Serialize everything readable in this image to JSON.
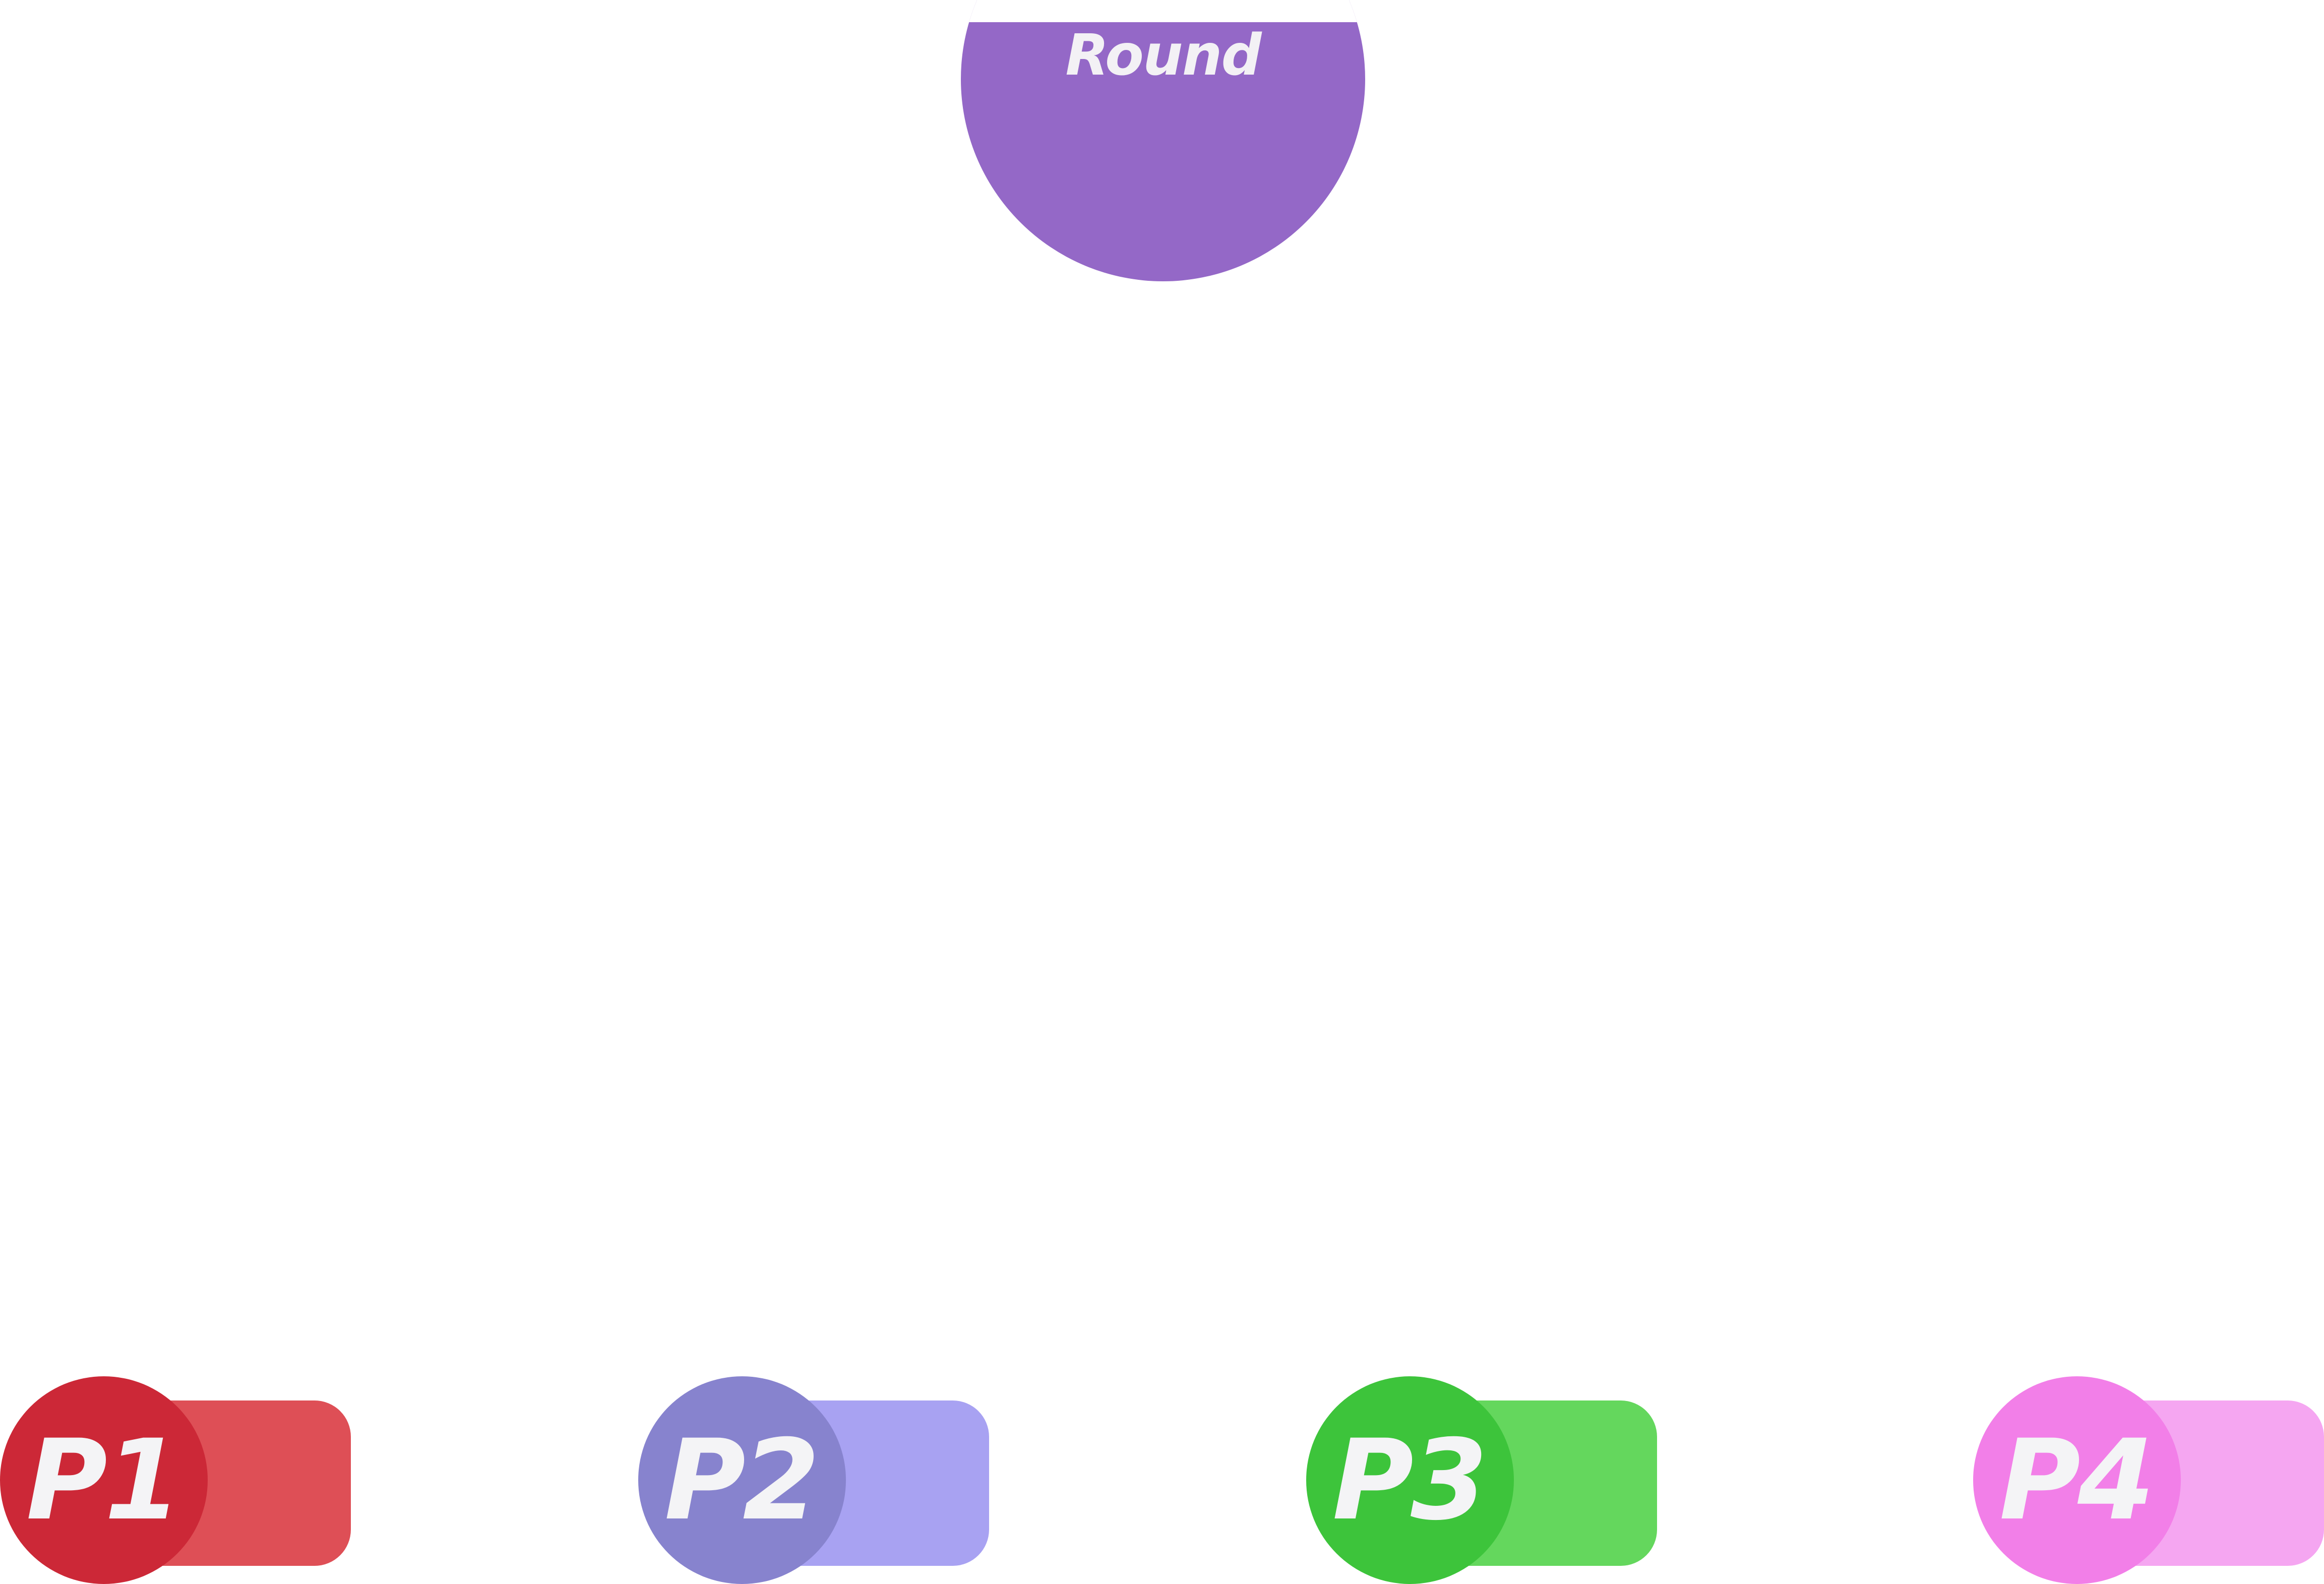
{
  "round": {
    "label": "Round",
    "color": "#9468c7"
  },
  "players": [
    {
      "id": "p1",
      "label": "P1",
      "token_color": "#cc2837",
      "bar_color": "#de4f56"
    },
    {
      "id": "p2",
      "label": "P2",
      "token_color": "#8783ce",
      "bar_color": "#a8a2f2"
    },
    {
      "id": "p3",
      "label": "P3",
      "token_color": "#3dc43b",
      "bar_color": "#64d75d"
    },
    {
      "id": "p4",
      "label": "P4",
      "token_color": "#f27fe8",
      "bar_color": "#f5a6f1"
    }
  ]
}
